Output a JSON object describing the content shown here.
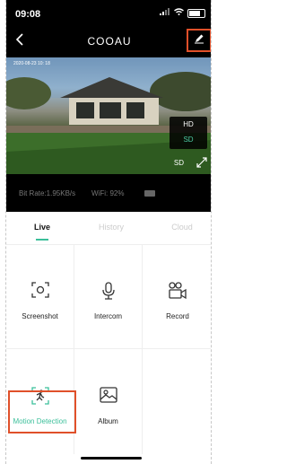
{
  "status": {
    "time": "09:08"
  },
  "nav": {
    "title": "COOAU"
  },
  "video": {
    "timestamp": "2020-08-23  10: 18",
    "quality_hd": "HD",
    "quality_sd": "SD",
    "quality_current": "SD"
  },
  "info": {
    "bitrate": "Bit Rate:1.95KB/s",
    "wifi": "WiFi: 92%"
  },
  "tabs": {
    "live": "Live",
    "history": "History",
    "cloud": "Cloud"
  },
  "actions": [
    {
      "label": "Screenshot",
      "icon": "screenshot-icon"
    },
    {
      "label": "Intercom",
      "icon": "microphone-icon"
    },
    {
      "label": "Record",
      "icon": "video-record-icon"
    },
    {
      "label": "Motion Detection",
      "icon": "motion-detection-icon"
    },
    {
      "label": "Album",
      "icon": "album-icon"
    }
  ],
  "colors": {
    "accent": "#3bbf9a",
    "highlight": "#e0502a",
    "background": "#000000"
  }
}
